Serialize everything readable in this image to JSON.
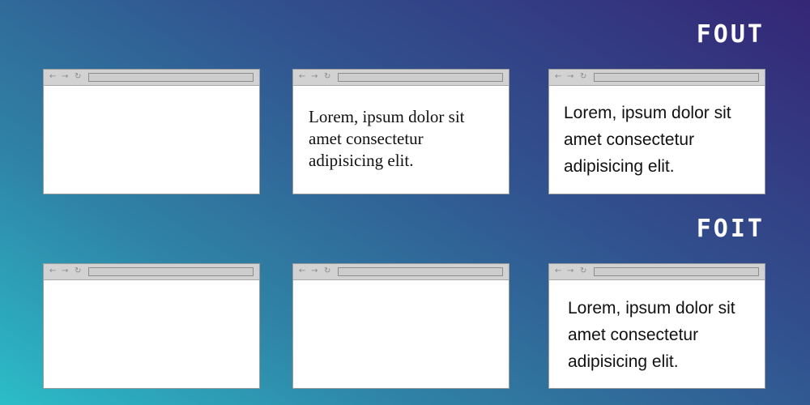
{
  "headings": {
    "fout": "FOUT",
    "foit": "FOIT"
  },
  "browser_chrome": {
    "back_icon": "←",
    "forward_icon": "→",
    "reload_icon": "↻"
  },
  "fout_row": {
    "browser_2_text": "Lorem, ipsum dolor sit amet consectetur adipisicing elit.",
    "browser_3_text": "Lorem, ipsum dolor sit amet consectetur adipisicing elit."
  },
  "foit_row": {
    "browser_3_text": "Lorem, ipsum dolor sit amet consectetur adipisicing elit."
  },
  "colors": {
    "gradient_start": "#2bbdc8",
    "gradient_end": "#352676",
    "heading": "#ffffff",
    "window": "#ffffff",
    "chrome": "#d2d2d2"
  }
}
